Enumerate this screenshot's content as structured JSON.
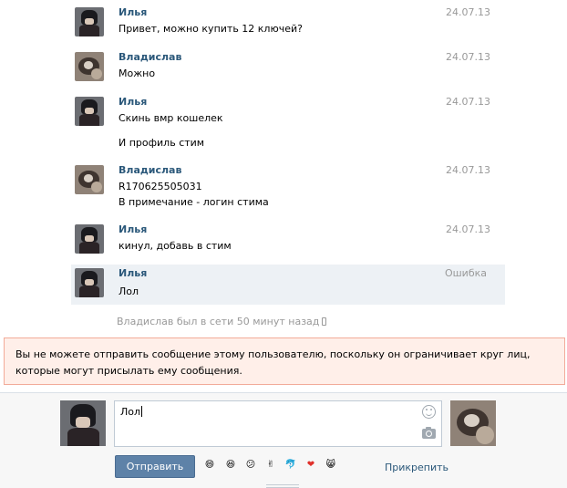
{
  "messages": [
    {
      "author": "Илья",
      "date": "24.07.13",
      "lines": [
        "Привет, можно купить 12 ключей?"
      ]
    },
    {
      "author": "Владислав",
      "date": "24.07.13",
      "lines": [
        "Можно"
      ]
    },
    {
      "author": "Илья",
      "date": "24.07.13",
      "lines": [
        "Скинь вмр кошелек",
        "И профиль стим"
      ]
    },
    {
      "author": "Владислав",
      "date": "24.07.13",
      "lines": [
        "R170625505031",
        "В примечание - логин стима"
      ]
    },
    {
      "author": "Илья",
      "date": "24.07.13",
      "lines": [
        "кинул, добавь в стим"
      ]
    },
    {
      "author": "Илья",
      "date": "Ошибка",
      "lines": [
        "Лол"
      ]
    }
  ],
  "status": {
    "text": "Владислав был в сети 50 минут назад"
  },
  "error": {
    "text": "Вы не можете отправить сообщение этому пользователю, поскольку он ограничивает круг лиц, которые могут присылать ему сообщения."
  },
  "composer": {
    "input_value": "Лол",
    "send_label": "Отправить",
    "attach_label": "Прикрепить",
    "emojis": [
      "😄",
      "😆",
      "😕",
      "✌",
      "🐬",
      "❤",
      "😸"
    ]
  },
  "colors": {
    "link": "#2b587a",
    "button": "#5e82a8",
    "error_bg": "#ffefe9",
    "error_border": "#f2ab99",
    "highlight": "#edf1f5"
  }
}
